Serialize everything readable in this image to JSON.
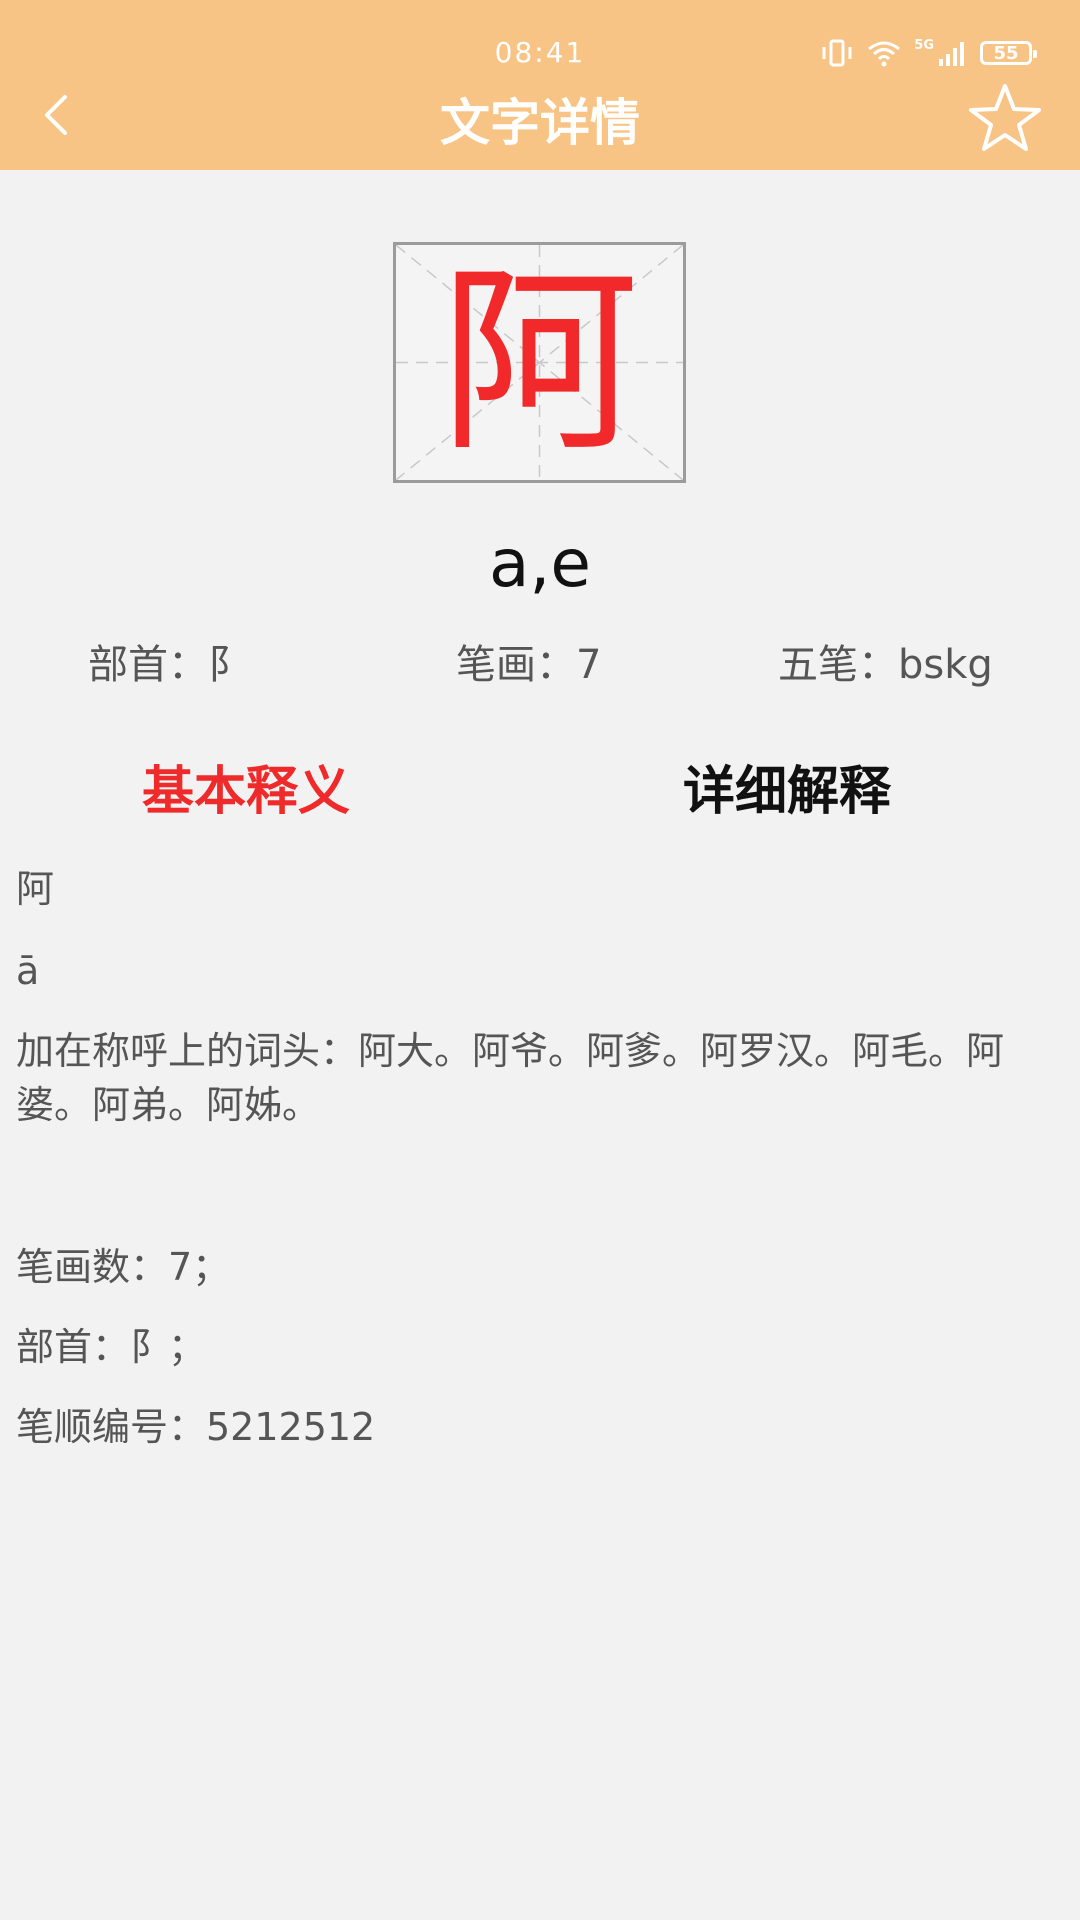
{
  "status_bar": {
    "time": "08:41",
    "network": "5G",
    "battery": "55"
  },
  "header": {
    "title": "文字详情",
    "back_icon": "chevron-left-icon",
    "favorite_icon": "star-outline-icon"
  },
  "character": {
    "glyph": "阿",
    "pinyin": "a,e"
  },
  "info": {
    "radical_label": "部首：",
    "radical_value": "阝",
    "strokes_label": "笔画：",
    "strokes_value": "7",
    "wubi_label": "五笔：",
    "wubi_value": "bskg"
  },
  "tabs": {
    "basic": "基本释义",
    "detail": "详细解释"
  },
  "definition": {
    "line1": "阿",
    "line2": "ā",
    "line3": "加在称呼上的词头：阿大。阿爷。阿爹。阿罗汉。阿毛。阿婆。阿弟。阿姊。",
    "line4": "笔画数：7；",
    "line5": "部首：阝；",
    "line6": "笔顺编号：5212512"
  },
  "colors": {
    "header_bg": "#f8c485",
    "accent_red": "#ef2a2a",
    "page_bg": "#f3f2f3"
  }
}
